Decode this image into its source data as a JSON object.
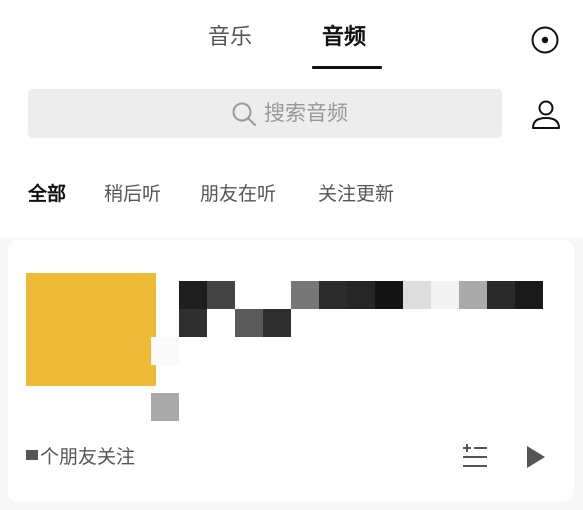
{
  "header": {
    "tabs": [
      {
        "label": "音乐",
        "active": false
      },
      {
        "label": "音频",
        "active": true
      }
    ]
  },
  "search": {
    "placeholder": "搜索音频"
  },
  "filters": [
    {
      "label": "全部",
      "active": true
    },
    {
      "label": "稍后听",
      "active": false
    },
    {
      "label": "朋友在听",
      "active": false
    },
    {
      "label": "关注更新",
      "active": false
    }
  ],
  "card": {
    "cover_color": "#eebb37",
    "meta_text": "个朋友关注"
  },
  "colors": {
    "accent": "#111111",
    "background": "#f7f7f7",
    "card": "#ffffff"
  },
  "icons": [
    "target-icon",
    "search-icon",
    "user-icon",
    "add-to-playlist-icon",
    "play-icon"
  ]
}
